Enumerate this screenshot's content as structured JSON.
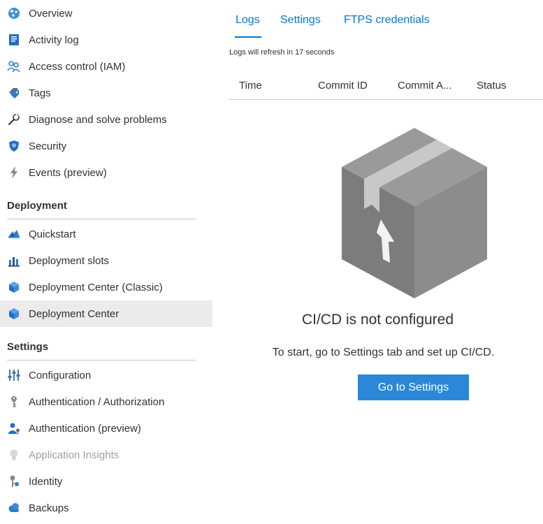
{
  "sidebar": {
    "items_top": [
      {
        "label": "Overview",
        "icon": "overview-icon"
      },
      {
        "label": "Activity log",
        "icon": "activity-log-icon"
      },
      {
        "label": "Access control (IAM)",
        "icon": "people-icon"
      },
      {
        "label": "Tags",
        "icon": "tag-icon"
      },
      {
        "label": "Diagnose and solve problems",
        "icon": "wrench-icon"
      },
      {
        "label": "Security",
        "icon": "shield-icon"
      },
      {
        "label": "Events (preview)",
        "icon": "lightning-icon"
      }
    ],
    "deployment": {
      "title": "Deployment",
      "items": [
        {
          "label": "Quickstart",
          "icon": "quickstart-icon"
        },
        {
          "label": "Deployment slots",
          "icon": "slots-icon"
        },
        {
          "label": "Deployment Center (Classic)",
          "icon": "cube-icon"
        },
        {
          "label": "Deployment Center",
          "icon": "cube-icon",
          "selected": true
        }
      ]
    },
    "settings": {
      "title": "Settings",
      "items": [
        {
          "label": "Configuration",
          "icon": "sliders-icon"
        },
        {
          "label": "Authentication / Authorization",
          "icon": "key-icon"
        },
        {
          "label": "Authentication (preview)",
          "icon": "user-key-icon"
        },
        {
          "label": "Application Insights",
          "icon": "lightbulb-icon",
          "disabled": true
        },
        {
          "label": "Identity",
          "icon": "identity-icon"
        },
        {
          "label": "Backups",
          "icon": "cloud-icon"
        }
      ]
    }
  },
  "main": {
    "tabs": [
      {
        "label": "Logs",
        "active": true
      },
      {
        "label": "Settings"
      },
      {
        "label": "FTPS credentials"
      }
    ],
    "refresh_note": "Logs will refresh in 17 seconds",
    "columns": [
      "Time",
      "Commit ID",
      "Commit A...",
      "Status"
    ],
    "empty_state": {
      "title": "CI/CD is not configured",
      "description": "To start, go to Settings tab and set up CI/CD.",
      "button_label": "Go to Settings"
    }
  },
  "colors": {
    "accent": "#0078d4",
    "button": "#2b88d8",
    "selected_bg": "#ebebeb"
  }
}
